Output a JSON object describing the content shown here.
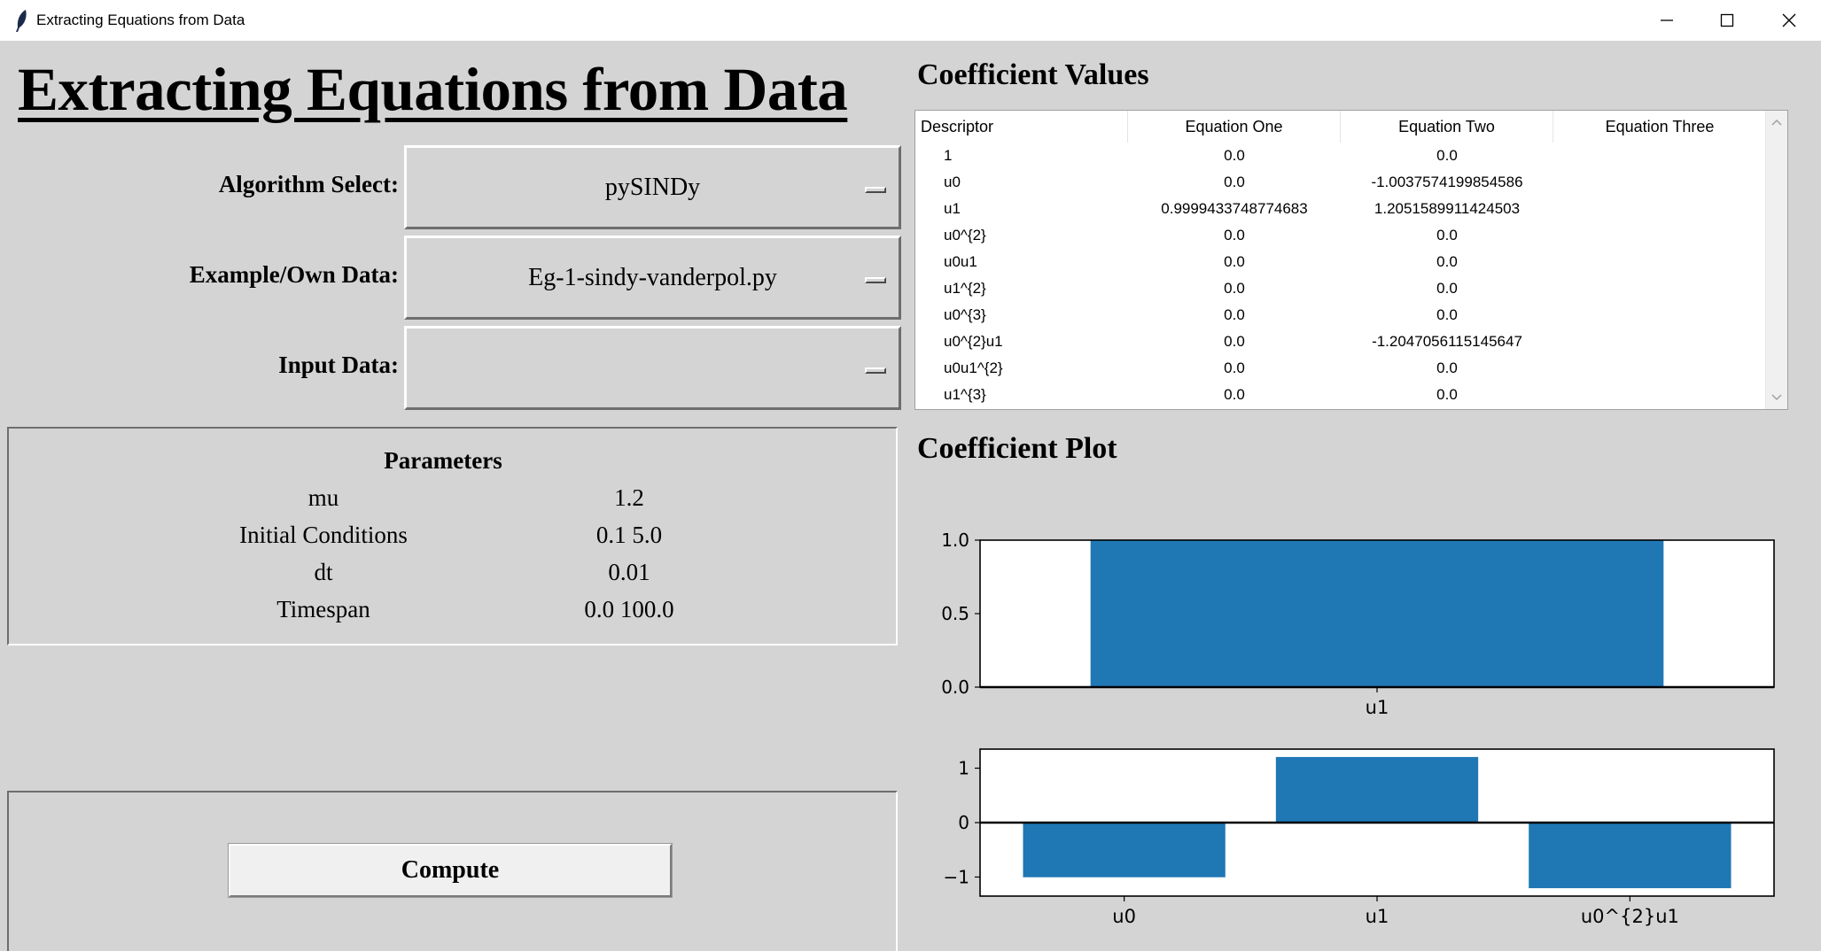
{
  "window": {
    "title": "Extracting Equations from Data"
  },
  "header": {
    "title": "Extracting Equations from Data"
  },
  "selectors": [
    {
      "label": "Algorithm Select:",
      "value": "pySINDy"
    },
    {
      "label": "Example/Own Data:",
      "value": "Eg-1-sindy-vanderpol.py"
    },
    {
      "label": "Input Data:",
      "value": ""
    }
  ],
  "parameters": {
    "title": "Parameters",
    "rows": [
      {
        "name": "mu",
        "value": "1.2"
      },
      {
        "name": "Initial Conditions",
        "value": "0.1 5.0"
      },
      {
        "name": "dt",
        "value": "0.01"
      },
      {
        "name": "Timespan",
        "value": "0.0 100.0"
      }
    ]
  },
  "compute": {
    "label": "Compute"
  },
  "coefficients": {
    "title": "Coefficient Values",
    "columns": [
      "Descriptor",
      "Equation One",
      "Equation Two",
      "Equation Three"
    ],
    "rows": [
      [
        "1",
        "0.0",
        "0.0",
        ""
      ],
      [
        "u0",
        "0.0",
        "-1.0037574199854586",
        ""
      ],
      [
        "u1",
        "0.9999433748774683",
        "1.2051589911424503",
        ""
      ],
      [
        "u0^{2}",
        "0.0",
        "0.0",
        ""
      ],
      [
        "u0u1",
        "0.0",
        "0.0",
        ""
      ],
      [
        "u1^{2}",
        "0.0",
        "0.0",
        ""
      ],
      [
        "u0^{3}",
        "0.0",
        "0.0",
        ""
      ],
      [
        "u0^{2}u1",
        "0.0",
        "-1.2047056115145647",
        ""
      ],
      [
        "u0u1^{2}",
        "0.0",
        "0.0",
        ""
      ],
      [
        "u1^{3}",
        "0.0",
        "0.0",
        ""
      ]
    ]
  },
  "plot": {
    "title": "Coefficient Plot"
  },
  "chart_data": [
    {
      "type": "bar",
      "categories": [
        "u1"
      ],
      "values": [
        0.9999433748774683
      ],
      "ylim": [
        0,
        1.0
      ],
      "yticks": [
        "0.0",
        "0.5",
        "1.0"
      ],
      "color": "#1f77b4"
    },
    {
      "type": "bar",
      "categories": [
        "u0",
        "u1",
        "u0^{2}u1"
      ],
      "values": [
        -1.0037574199854586,
        1.2051589911424503,
        -1.2047056115145647
      ],
      "ylim": [
        -1.35,
        1.35
      ],
      "yticks": [
        "−1",
        "0",
        "1"
      ],
      "color": "#1f77b4"
    }
  ]
}
